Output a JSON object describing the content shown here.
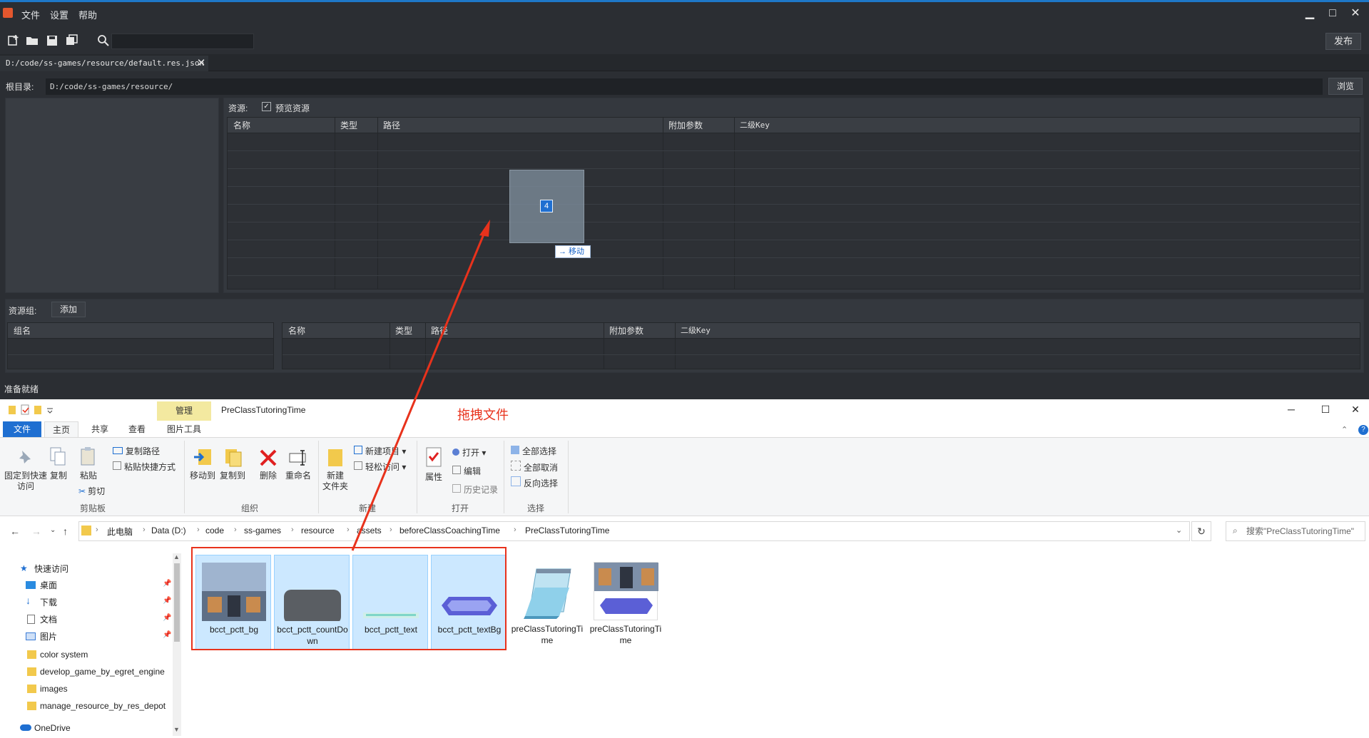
{
  "app": {
    "menu": [
      "文件",
      "设置",
      "帮助"
    ],
    "publish": "发布",
    "tab_file": "D:/code/ss-games/resource/default.res.json",
    "root_label": "根目录:",
    "root_value": "D:/code/ss-games/resource/",
    "browse": "浏览",
    "res_label": "资源:",
    "preview_label": "预览资源",
    "res_columns": [
      "名称",
      "类型",
      "路径",
      "附加参数",
      "二级Key"
    ],
    "group_label": "资源组:",
    "add": "添加",
    "group_column": "组名",
    "group_res_columns": [
      "名称",
      "类型",
      "路径",
      "附加参数",
      "二级Key"
    ],
    "status": "准备就绪",
    "drag_count": "4",
    "move_tip": "→ 移动"
  },
  "explorer": {
    "manage_tab": "管理",
    "title": "PreClassTutoringTime",
    "annotation": "拖拽文件",
    "ribbon_tabs": [
      "文件",
      "主页",
      "共享",
      "查看",
      "图片工具"
    ],
    "ribbon": {
      "pin": "固定到快速访问",
      "copy": "复制",
      "paste": "粘贴",
      "copy_path": "复制路径",
      "paste_shortcut": "粘贴快捷方式",
      "cut": "剪切",
      "clipboard": "剪贴板",
      "move_to": "移动到",
      "copy_to": "复制到",
      "delete": "删除",
      "rename": "重命名",
      "organize": "组织",
      "new_folder": "新建\n文件夹",
      "new_item": "新建项目",
      "easy_access": "轻松访问",
      "new": "新建",
      "properties": "属性",
      "open": "打开",
      "edit": "编辑",
      "history": "历史记录",
      "open_group": "打开",
      "select_all": "全部选择",
      "select_none": "全部取消",
      "invert": "反向选择",
      "select_group": "选择"
    },
    "breadcrumbs": [
      "此电脑",
      "Data (D:)",
      "code",
      "ss-games",
      "resource",
      "assets",
      "beforeClassCoachingTime",
      "PreClassTutoringTime"
    ],
    "search_placeholder": "搜索\"PreClassTutoringTime\"",
    "nav": [
      "快速访问",
      "桌面",
      "下载",
      "文档",
      "图片",
      "color system",
      "develop_game_by_egret_engine",
      "images",
      "manage_resource_by_res_depot",
      "OneDrive"
    ],
    "files": [
      {
        "name": "bcct_pctt_bg",
        "selected": true
      },
      {
        "name": "bcct_pctt_countDown",
        "selected": true
      },
      {
        "name": "bcct_pctt_text",
        "selected": true
      },
      {
        "name": "bcct_pctt_textBg",
        "selected": true
      },
      {
        "name": "preClassTutoringTime",
        "selected": false
      },
      {
        "name": "preClassTutoringTime",
        "selected": false
      }
    ]
  },
  "colors": {
    "accent": "#1f6fd1",
    "annotation": "#e8321c",
    "dark_bg": "#2b2e33",
    "manage_tab": "#f3e9a0"
  }
}
